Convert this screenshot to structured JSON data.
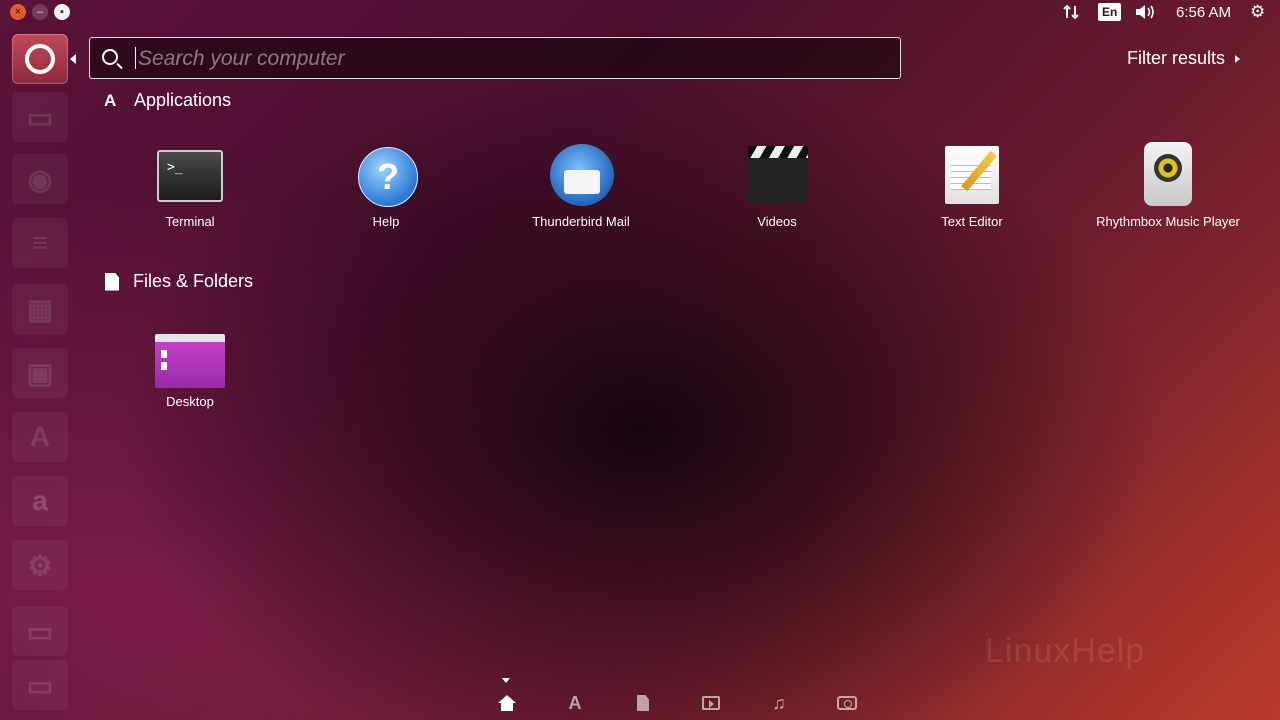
{
  "top_panel": {
    "window_buttons": [
      "close",
      "minimize",
      "maximize"
    ],
    "keyboard_layout": "En",
    "clock": "6:56 AM",
    "icons": [
      "network-transfer-icon",
      "volume-icon",
      "power-gear-icon"
    ]
  },
  "launcher": {
    "items": [
      "ubuntu-dash",
      "files",
      "firefox",
      "libreoffice-writer",
      "libreoffice-calc",
      "libreoffice-impress",
      "software-center",
      "amazon",
      "system-settings",
      "terminal",
      "trash"
    ]
  },
  "search": {
    "placeholder": "Search your computer",
    "value": ""
  },
  "filter": {
    "label": "Filter results"
  },
  "sections": {
    "applications": {
      "title": "Applications",
      "items": [
        {
          "label": "Terminal",
          "icon": "terminal-icon"
        },
        {
          "label": "Help",
          "icon": "help-icon"
        },
        {
          "label": "Thunderbird Mail",
          "icon": "thunderbird-icon"
        },
        {
          "label": "Videos",
          "icon": "videos-icon"
        },
        {
          "label": "Text Editor",
          "icon": "text-editor-icon"
        },
        {
          "label": "Rhythmbox Music Player",
          "icon": "rhythmbox-icon"
        }
      ]
    },
    "files": {
      "title": "Files & Folders",
      "items": [
        {
          "label": "Desktop",
          "icon": "folder-icon"
        }
      ]
    }
  },
  "lens_bar": {
    "lenses": [
      "home",
      "applications",
      "files",
      "video",
      "music",
      "photos"
    ],
    "active": "home"
  },
  "watermark": "LinuxHelp",
  "colors": {
    "accent": "#e25a2c",
    "background_dark": "#2a0818",
    "background_light": "#b83a2a"
  }
}
